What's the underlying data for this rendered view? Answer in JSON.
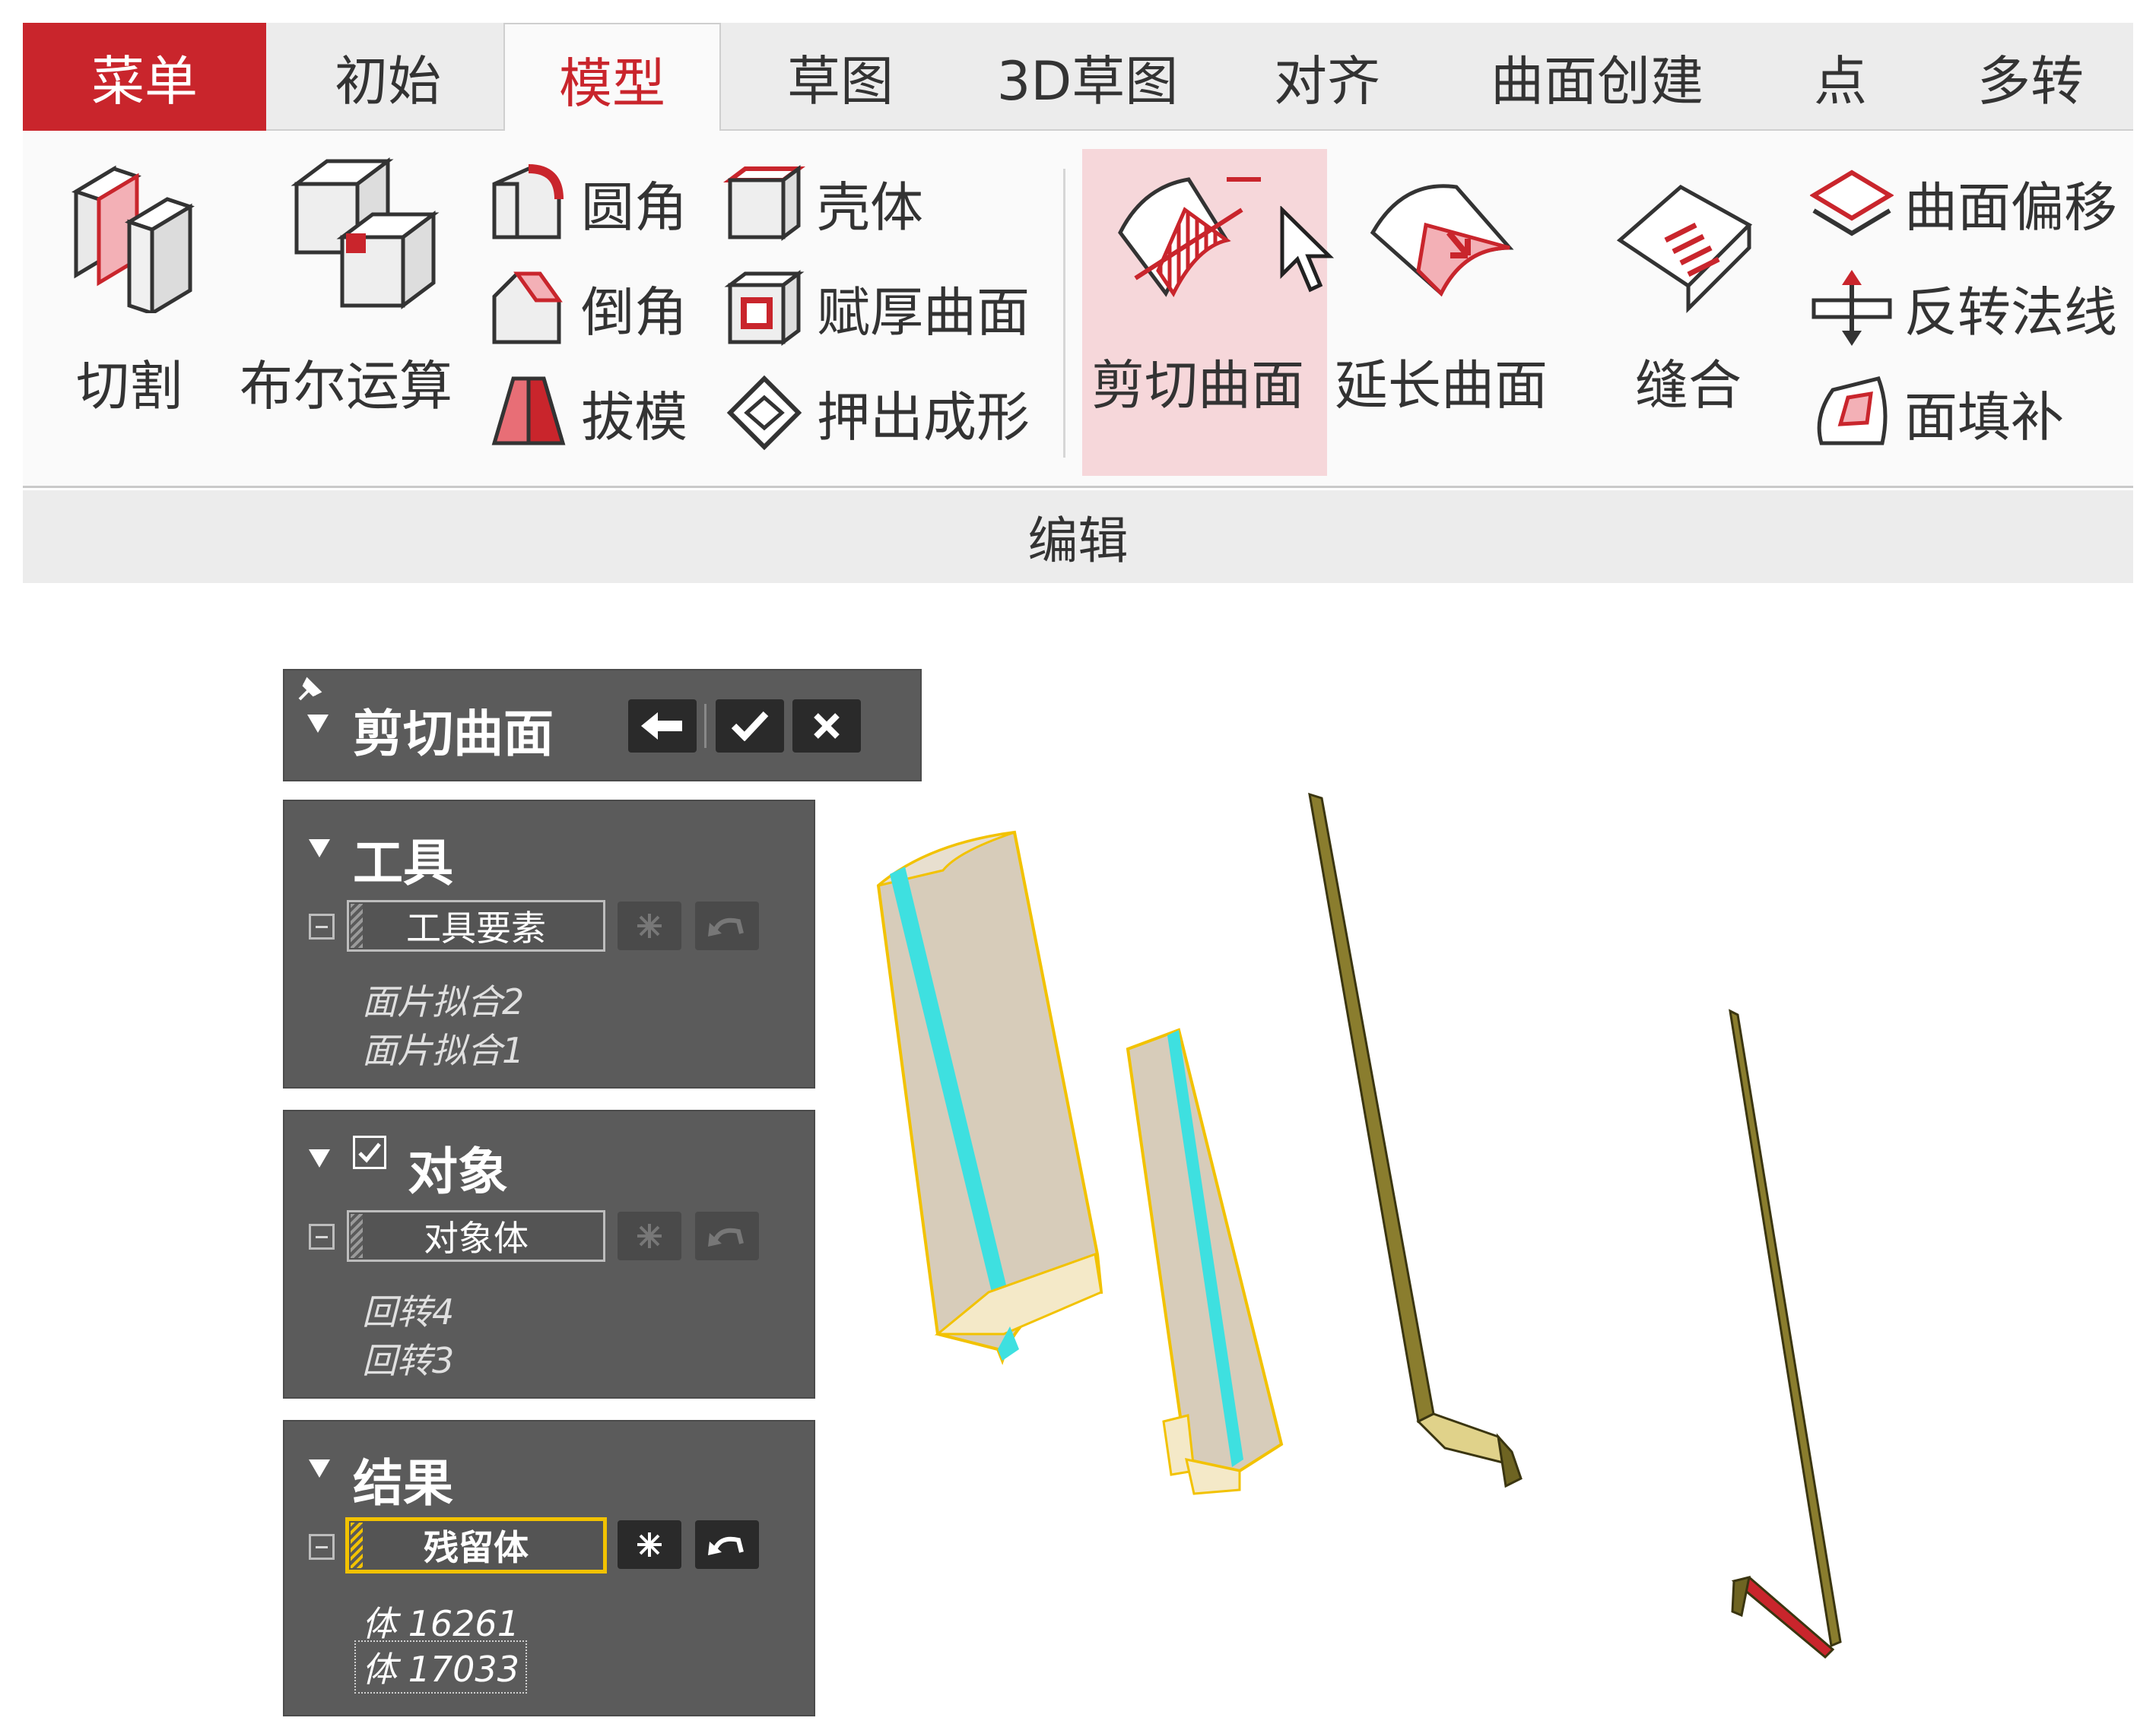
{
  "tabs": [
    {
      "label": "菜单"
    },
    {
      "label": "初始"
    },
    {
      "label": "模型"
    },
    {
      "label": "草图"
    },
    {
      "label": "3D草图"
    },
    {
      "label": "对齐"
    },
    {
      "label": "曲面创建"
    },
    {
      "label": "点"
    },
    {
      "label": "多转"
    }
  ],
  "ribbon": {
    "cut": "切割",
    "boolean": "布尔运算",
    "fillet": "圆角",
    "chamfer": "倒角",
    "draft": "拔模",
    "shell": "壳体",
    "thicken": "赋厚曲面",
    "extrude_form": "押出成形",
    "trim_surface": "剪切曲面",
    "extend_surface": "延长曲面",
    "sew": "缝合",
    "offset_surface": "曲面偏移",
    "flip_normal": "反转法线",
    "fill_face": "面填补",
    "group_label": "编辑"
  },
  "dialog": {
    "title": "剪切曲面",
    "tool_section": {
      "title": "工具",
      "field": "工具要素",
      "items": [
        "面片拟合2",
        "面片拟合1"
      ]
    },
    "object_section": {
      "title": "对象",
      "field": "对象体",
      "items": [
        "回转4",
        "回转3"
      ]
    },
    "result_section": {
      "title": "结果",
      "field": "残留体",
      "items": [
        "体 16261",
        "体 17033"
      ]
    }
  },
  "colors": {
    "accent_red": "#c9252c",
    "selection_yellow": "#f2c200",
    "panel_bg": "#5b5b5b",
    "highlight_cyan": "#3ee0e0"
  }
}
